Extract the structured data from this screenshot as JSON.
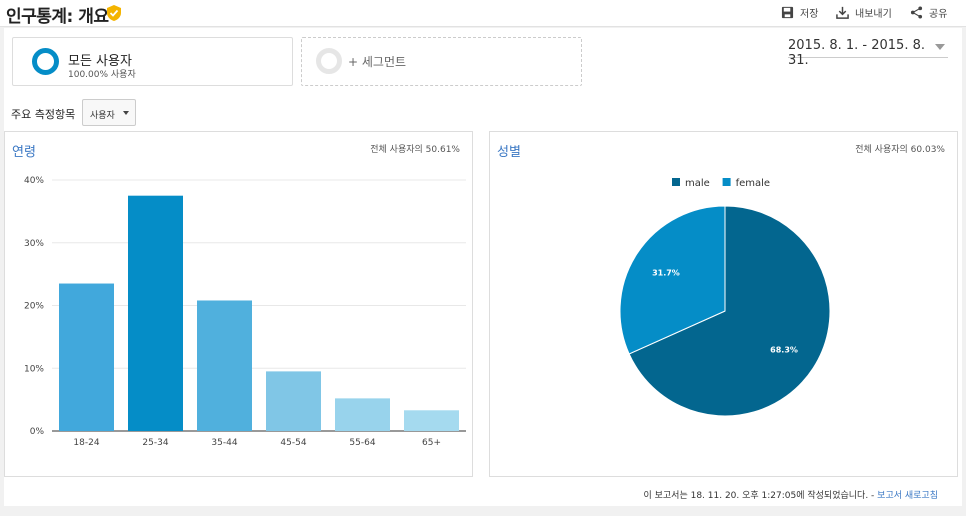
{
  "header": {
    "title": "인구통계: 개요",
    "save_label": "저장",
    "export_label": "내보내기",
    "share_label": "공유"
  },
  "segments": {
    "active_name": "모든 사용자",
    "active_sub": "100.00% 사용자",
    "add_label": "+ 세그먼트"
  },
  "date_range": "2015. 8. 1. - 2015. 8. 31.",
  "metric": {
    "label": "주요 측정항목",
    "selected": "사용자"
  },
  "age_card": {
    "title": "연령",
    "note": "전체 사용자의 50.61%"
  },
  "gender_card": {
    "title": "성별",
    "note": "전체 사용자의 60.03%"
  },
  "footer": {
    "text": "이 보고서는 18. 11. 20. 오후 1:27:05에 작성되었습니다. - ",
    "refresh_link": "보고서 새로고침"
  },
  "chart_data": [
    {
      "type": "bar",
      "title": "연령",
      "categories": [
        "18-24",
        "25-34",
        "35-44",
        "45-54",
        "55-64",
        "65+"
      ],
      "values": [
        23.5,
        37.5,
        20.8,
        9.5,
        5.2,
        3.3
      ],
      "y_ticks": [
        "0%",
        "10%",
        "20%",
        "30%",
        "40%"
      ],
      "ylim": [
        0,
        40
      ],
      "colors": [
        "#41a8dc",
        "#058dc7",
        "#50b0dd",
        "#80c6e6",
        "#98d3ec",
        "#a5daef"
      ],
      "grid": true
    },
    {
      "type": "pie",
      "title": "성별",
      "labels": [
        "male",
        "female"
      ],
      "values": [
        68.3,
        31.7
      ],
      "data_labels": [
        "68.3%",
        "31.7%"
      ],
      "colors": [
        "#03668f",
        "#058dc7"
      ],
      "legend": "top"
    }
  ]
}
